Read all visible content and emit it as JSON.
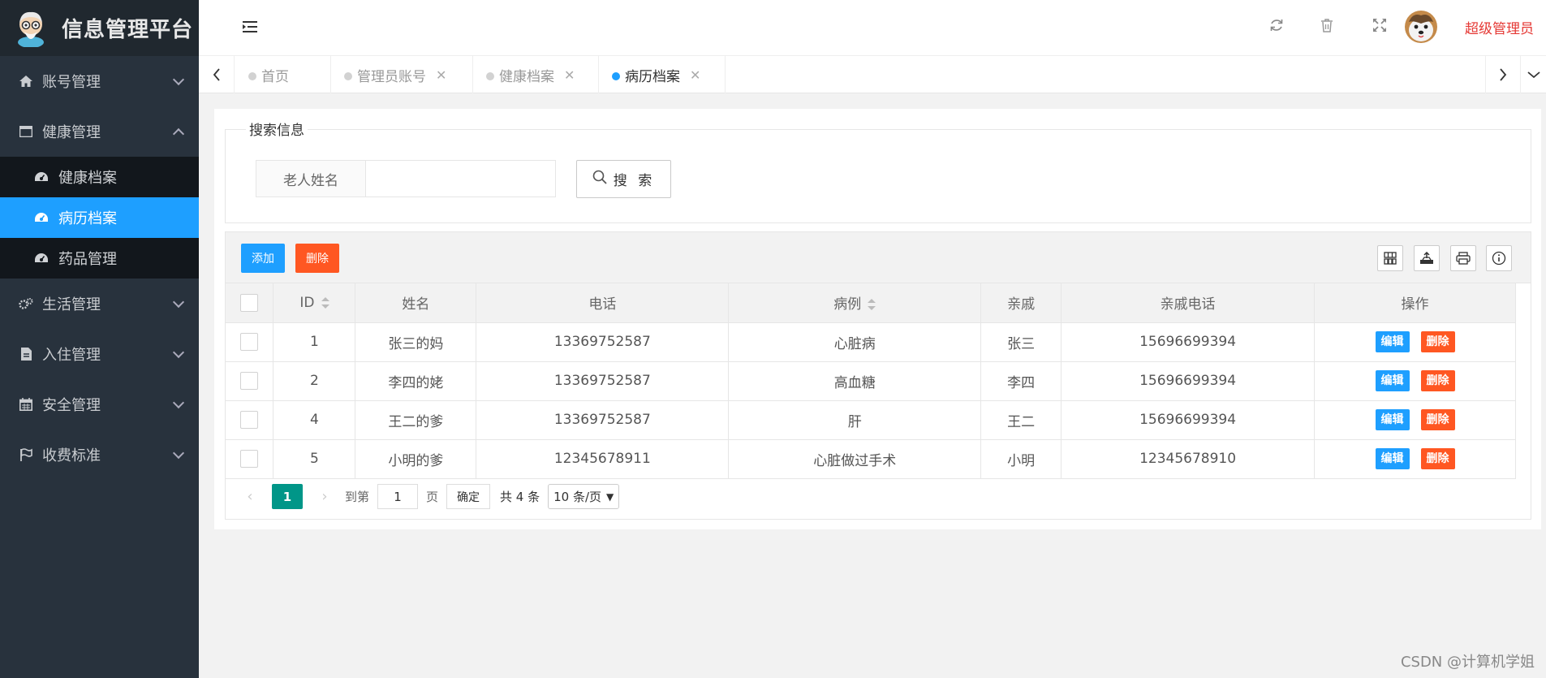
{
  "app": {
    "title": "信息管理平台"
  },
  "sidebar": {
    "items": [
      {
        "label": "账号管理",
        "icon": "home-icon",
        "expanded": false
      },
      {
        "label": "健康管理",
        "icon": "window-icon",
        "expanded": true,
        "children": [
          {
            "label": "健康档案",
            "icon": "dashboard-icon",
            "active": false
          },
          {
            "label": "病历档案",
            "icon": "dashboard-icon",
            "active": true
          },
          {
            "label": "药品管理",
            "icon": "dashboard-icon",
            "active": false
          }
        ]
      },
      {
        "label": "生活管理",
        "icon": "gears-icon",
        "expanded": false
      },
      {
        "label": "入住管理",
        "icon": "file-icon",
        "expanded": false
      },
      {
        "label": "安全管理",
        "icon": "calendar-icon",
        "expanded": false
      },
      {
        "label": "收费标准",
        "icon": "flag-icon",
        "expanded": false
      }
    ]
  },
  "header": {
    "user_name": "超级管理员"
  },
  "tabs": [
    {
      "label": "首页",
      "closable": false,
      "active": false
    },
    {
      "label": "管理员账号",
      "closable": true,
      "active": false
    },
    {
      "label": "健康档案",
      "closable": true,
      "active": false
    },
    {
      "label": "病历档案",
      "closable": true,
      "active": true
    }
  ],
  "search": {
    "legend": "搜索信息",
    "field_label": "老人姓名",
    "field_value": "",
    "button_label": "搜 索"
  },
  "toolbar": {
    "add_label": "添加",
    "delete_label": "删除"
  },
  "table": {
    "columns": [
      "ID",
      "姓名",
      "电话",
      "病例",
      "亲戚",
      "亲戚电话",
      "操作"
    ],
    "rows": [
      {
        "id": "1",
        "name": "张三的妈",
        "phone": "13369752587",
        "case": "心脏病",
        "relative": "张三",
        "relative_phone": "15696699394"
      },
      {
        "id": "2",
        "name": "李四的姥",
        "phone": "13369752587",
        "case": "高血糖",
        "relative": "李四",
        "relative_phone": "15696699394"
      },
      {
        "id": "4",
        "name": "王二的爹",
        "phone": "13369752587",
        "case": "肝",
        "relative": "王二",
        "relative_phone": "15696699394"
      },
      {
        "id": "5",
        "name": "小明的爹",
        "phone": "12345678911",
        "case": "心脏做过手术",
        "relative": "小明",
        "relative_phone": "12345678910"
      }
    ],
    "edit_label": "编辑",
    "delete_label": "删除"
  },
  "pager": {
    "current": "1",
    "goto_label": "到第",
    "goto_value": "1",
    "page_unit": "页",
    "confirm_label": "确定",
    "total_text": "共 4 条",
    "page_size": "10 条/页"
  },
  "watermark": "CSDN @计算机学姐",
  "colors": {
    "primary": "#1e9fff",
    "danger": "#ff5722",
    "pager_active": "#009688",
    "sidebar_bg": "#28323d"
  }
}
